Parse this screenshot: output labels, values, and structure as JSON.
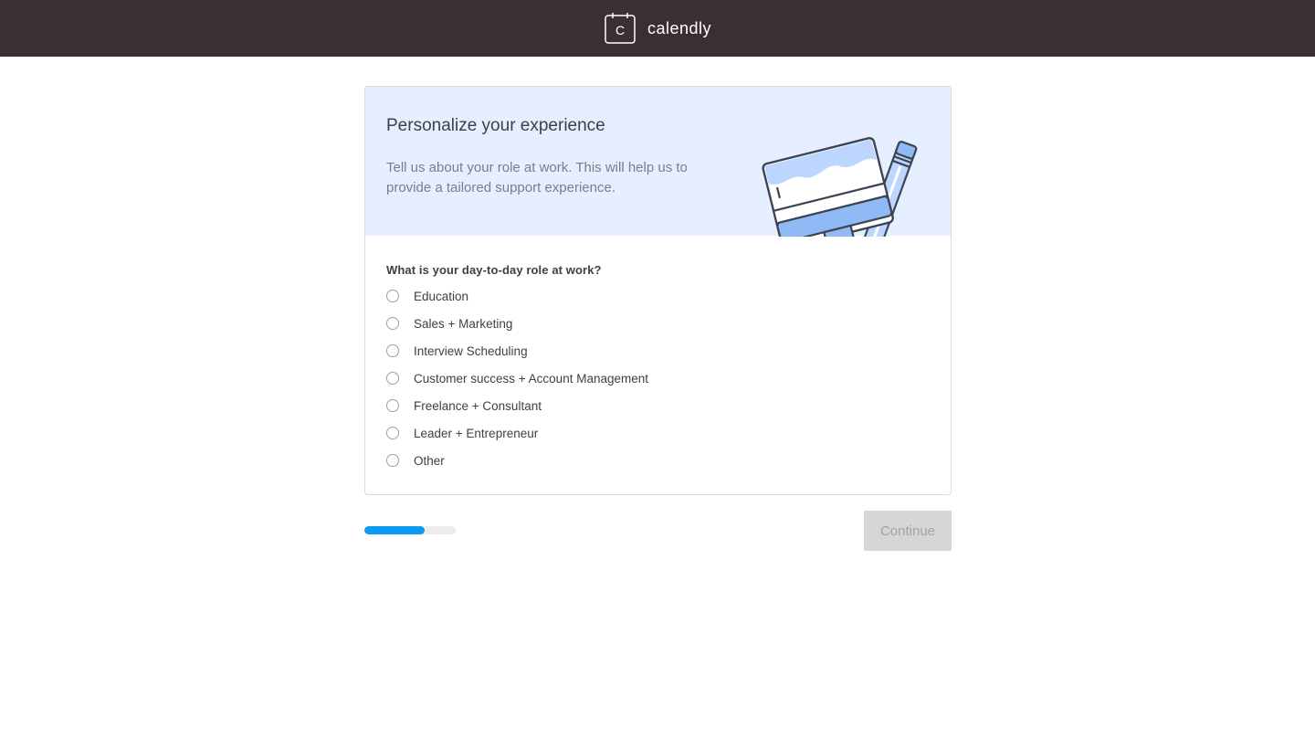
{
  "header": {
    "brand_name": "calendly",
    "logo_letter": "C",
    "background": "#3b2f33"
  },
  "card": {
    "title": "Personalize your experience",
    "subtitle": "Tell us about your role at work. This will help us to provide a tailored support experience.",
    "illustration_icon": "paint-brush-pencil-illustration",
    "header_background": "#e5efff"
  },
  "question": {
    "label": "What is your day-to-day role at work?",
    "options": [
      {
        "label": "Education",
        "selected": false
      },
      {
        "label": "Sales + Marketing",
        "selected": false
      },
      {
        "label": "Interview Scheduling",
        "selected": false
      },
      {
        "label": "Customer success + Account Management",
        "selected": false
      },
      {
        "label": "Freelance + Consultant",
        "selected": false
      },
      {
        "label": "Leader + Entrepreneur",
        "selected": false
      },
      {
        "label": "Other",
        "selected": false
      }
    ]
  },
  "footer": {
    "progress_fraction": 0.66,
    "progress_color": "#0a9cf5",
    "continue_label": "Continue",
    "continue_disabled": true
  }
}
